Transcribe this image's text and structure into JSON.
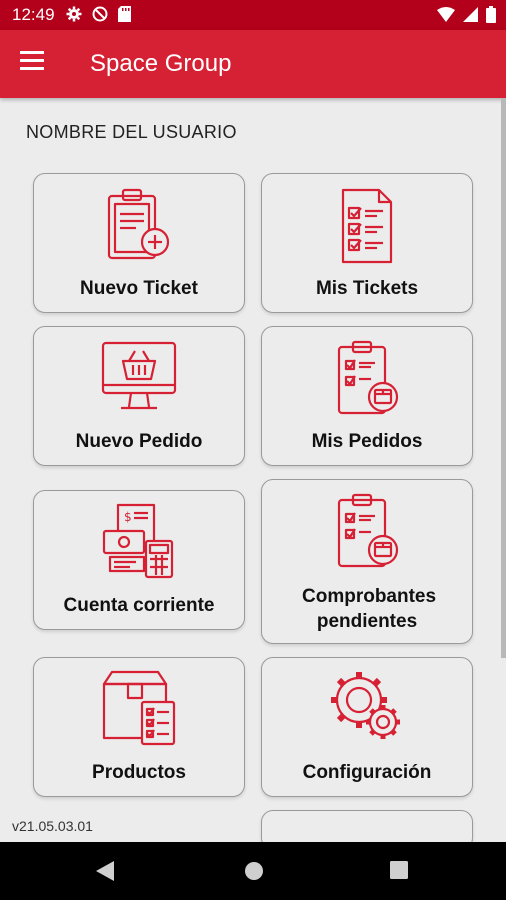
{
  "status_bar": {
    "time": "12:49",
    "icons": [
      "gear-icon",
      "no-disturb-icon",
      "sd-card-icon",
      "wifi-icon",
      "signal-icon",
      "battery-icon"
    ]
  },
  "app_bar": {
    "title": "Space Group",
    "menu_icon": "menu-icon"
  },
  "user": {
    "name": "NOMBRE DEL USUARIO"
  },
  "cards": [
    {
      "label": "Nuevo Ticket",
      "icon": "clipboard-plus-icon"
    },
    {
      "label": "Mis Tickets",
      "icon": "checklist-document-icon"
    },
    {
      "label": "Nuevo Pedido",
      "icon": "monitor-basket-icon"
    },
    {
      "label": "Mis Pedidos",
      "icon": "clipboard-box-icon"
    },
    {
      "label": "Cuenta corriente",
      "icon": "receipt-calculator-icon"
    },
    {
      "label": "Comprobantes pendientes",
      "icon": "clipboard-box-icon"
    },
    {
      "label": "Productos",
      "icon": "box-checklist-icon"
    },
    {
      "label": "Configuración",
      "icon": "gears-icon"
    }
  ],
  "version": "v21.05.03.01",
  "colors": {
    "status_bar": "#b3001b",
    "app_bar": "#d62134",
    "icon_red": "#d62134",
    "background": "#ececec"
  }
}
